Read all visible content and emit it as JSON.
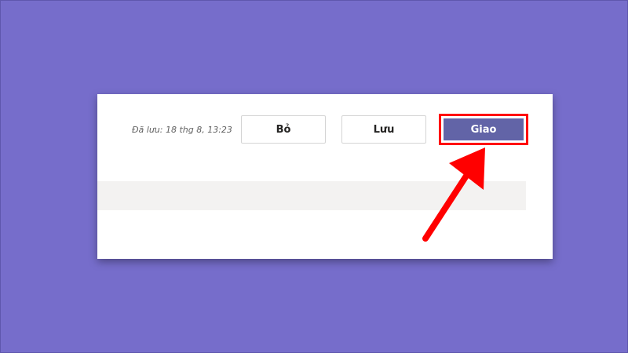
{
  "toolbar": {
    "saved_status": "Đã lưu: 18 thg 8, 13:23",
    "discard_label": "Bỏ",
    "save_label": "Lưu",
    "assign_label": "Giao"
  },
  "colors": {
    "background": "#766dcb",
    "assign_button": "#6264a7",
    "highlight": "#ff0000",
    "annotation_arrow": "#ff0000"
  },
  "annotation": {
    "arrow_icon": "red-arrow-icon"
  }
}
